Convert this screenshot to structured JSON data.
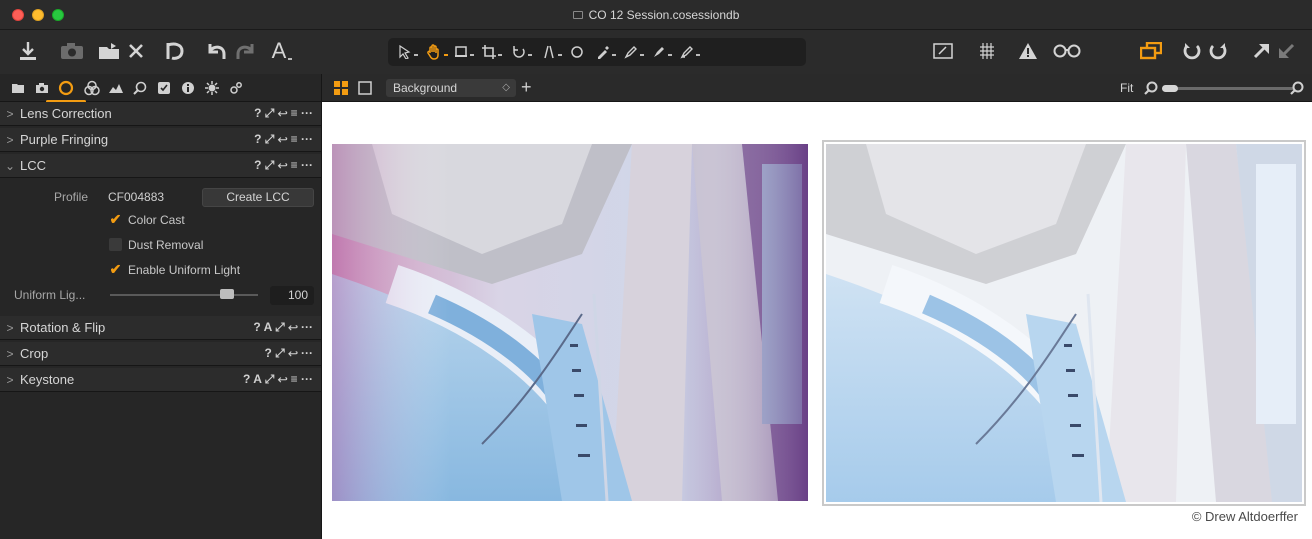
{
  "window": {
    "title": "CO 12 Session.cosessiondb"
  },
  "toolbar": {
    "text_tool_label": "A",
    "colors": {
      "accent": "#f39c12",
      "icon": "#d4d4d4",
      "bg": "#2b2b2b"
    },
    "left_icons": [
      "import-icon",
      "camera-icon",
      "folder-move-icon",
      "delete-icon",
      "undo-history-icon",
      "undo-icon",
      "redo-icon",
      "text-icon"
    ],
    "cursor_tools": [
      "select-icon",
      "pan-hand-icon",
      "loupe-icon",
      "crop-icon",
      "rotate-icon",
      "keystone-icon",
      "spot-icon",
      "picker-icon",
      "brush-icon",
      "eraser-icon",
      "gradient-icon"
    ],
    "right_icons": [
      "proof-icon",
      "grid-icon",
      "exposure-warning-icon",
      "glasses-icon",
      "variants-icon",
      "rotate-left-icon",
      "rotate-right-icon",
      "copy-adjustments-icon",
      "paste-adjustments-icon"
    ]
  },
  "tool_tabs": {
    "active_index": 2,
    "icons": [
      "library-icon",
      "capture-icon",
      "lens-icon",
      "color-icon",
      "exposure-icon",
      "details-icon",
      "adjustments-icon",
      "metadata-icon",
      "output-icon",
      "batch-icon"
    ]
  },
  "left_panel": {
    "tools": [
      {
        "name": "Lens Correction",
        "chevron": ">",
        "icons": "? ⤢ ↩ ≡ ···"
      },
      {
        "name": "Purple Fringing",
        "chevron": ">",
        "icons": "? ⤢ ↩ ≡ ···"
      },
      {
        "name": "LCC",
        "chevron": "⌄",
        "icons": "? ⤢ ↩ ≡ ···"
      },
      {
        "name": "Rotation & Flip",
        "chevron": ">",
        "icons": "? A ⤢ ↩ ···"
      },
      {
        "name": "Crop",
        "chevron": ">",
        "icons": "? ⤢ ↩ ···"
      },
      {
        "name": "Keystone",
        "chevron": ">",
        "icons": "? A ⤢ ↩ ≡ ···"
      }
    ],
    "lcc": {
      "profile_label": "Profile",
      "profile_value": "CF004883",
      "create_button": "Create LCC",
      "checkbox_color_cast": "Color Cast",
      "checkbox_dust_removal": "Dust Removal",
      "checkbox_uniform_light": "Enable Uniform Light",
      "color_cast_checked": true,
      "dust_removal_checked": false,
      "uniform_light_checked": true,
      "slider_label": "Uniform Lig...",
      "slider_value": "100",
      "slider_fraction": 0.8
    }
  },
  "viewer_bar": {
    "background_select": "Background",
    "fit_label": "Fit"
  },
  "viewer": {
    "credit": "© Drew Altdoerffer"
  }
}
